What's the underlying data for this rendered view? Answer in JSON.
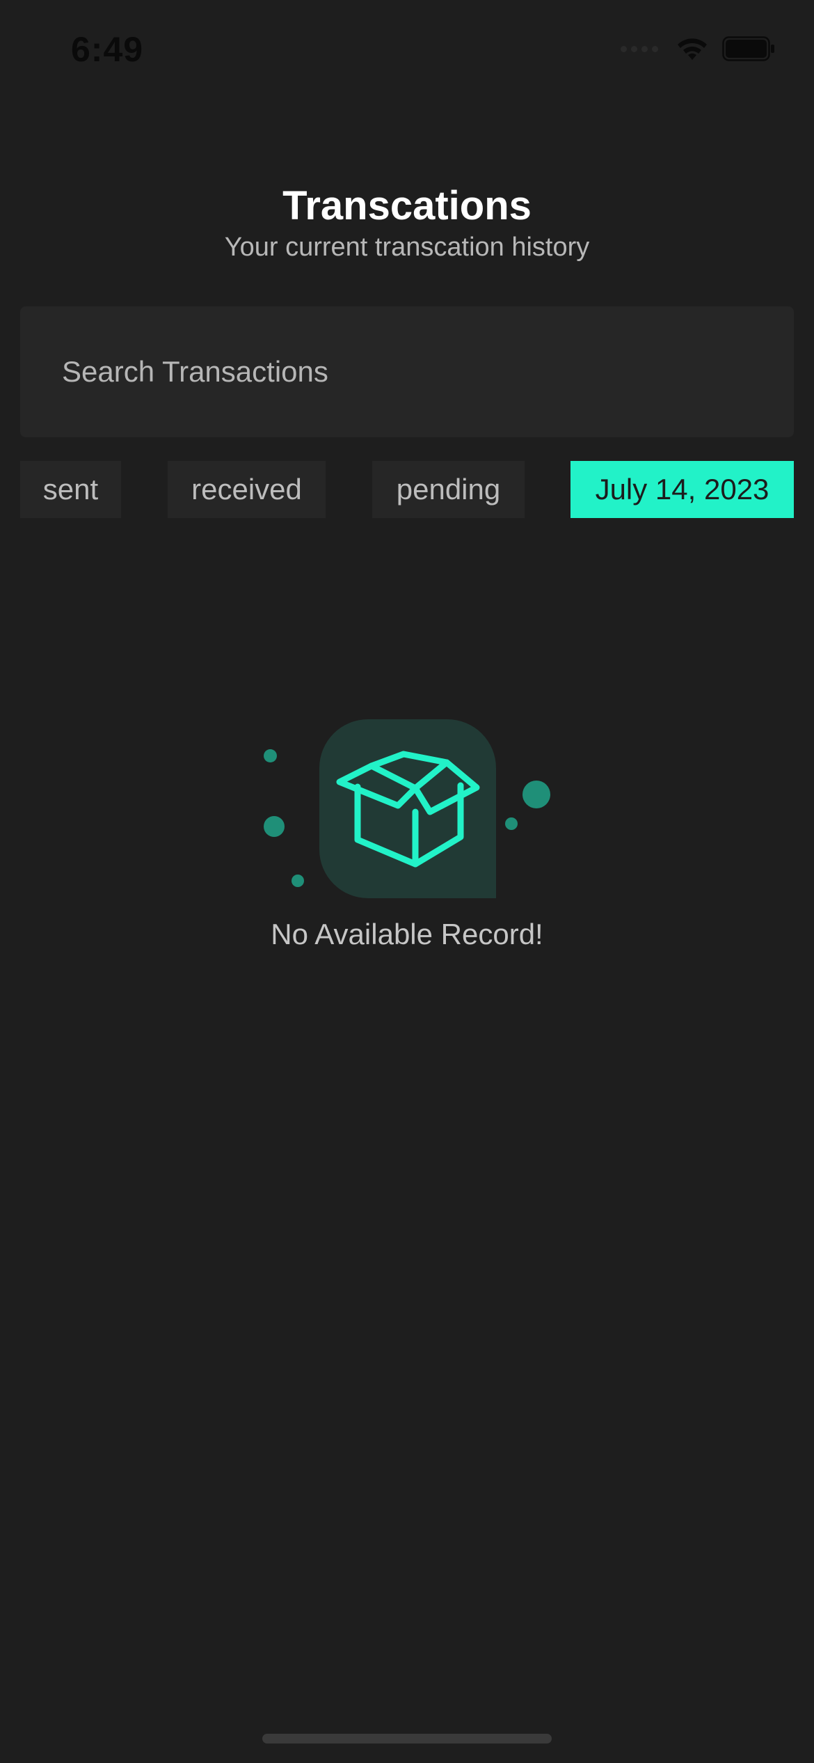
{
  "status_bar": {
    "time": "6:49",
    "icons": [
      "cellular-signal-icon",
      "wifi-icon",
      "battery-icon"
    ]
  },
  "header": {
    "title": "Transcations",
    "subtitle": "Your current transcation history"
  },
  "search": {
    "placeholder": "Search Transactions",
    "value": ""
  },
  "filters": [
    {
      "label": "sent",
      "selected": false
    },
    {
      "label": "received",
      "selected": false
    },
    {
      "label": "pending",
      "selected": false
    },
    {
      "label": "July 14, 2023",
      "selected": true
    }
  ],
  "empty_state": {
    "icon": "open-box-icon",
    "message": "No Available Record!"
  },
  "colors": {
    "background": "#1e1e1e",
    "surface": "#262626",
    "accent": "#22f2c8",
    "icon_card": "#213a35",
    "decor_dot": "#1f8f78"
  }
}
